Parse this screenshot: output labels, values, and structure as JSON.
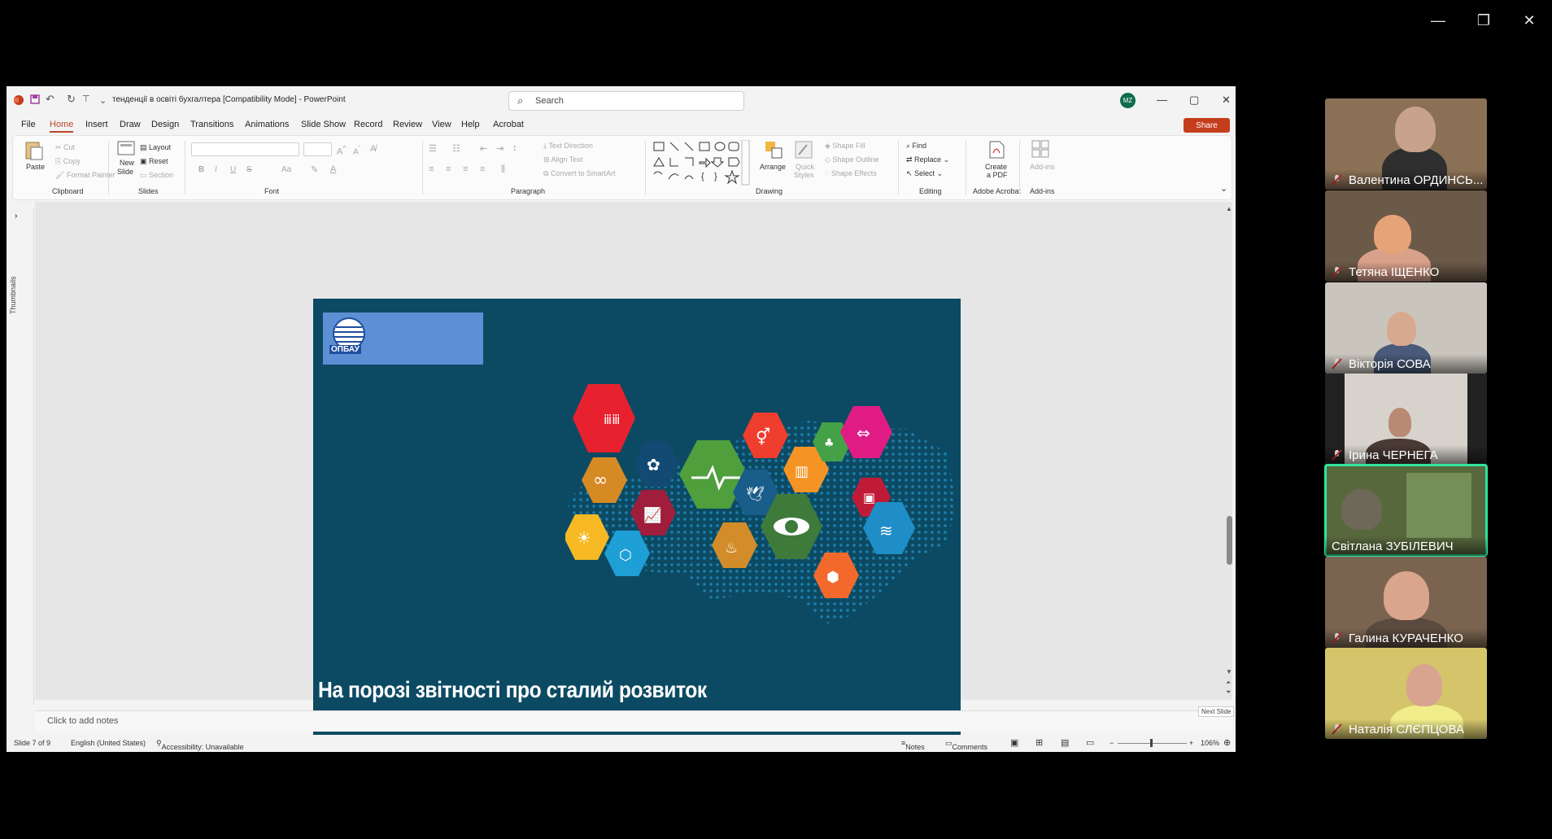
{
  "window_controls": {
    "minimize": "—",
    "restore": "❐",
    "close": "✕"
  },
  "powerpoint": {
    "title": "тенденції в освіті бухгалтера [Compatibility Mode]  -  PowerPoint",
    "search_placeholder": "Search",
    "user_initials": "MZ",
    "menu": [
      "File",
      "Home",
      "Insert",
      "Draw",
      "Design",
      "Transitions",
      "Animations",
      "Slide Show",
      "Record",
      "Review",
      "View",
      "Help",
      "Acrobat"
    ],
    "active_tab": "Home",
    "share_label": "Share",
    "ribbon": {
      "clipboard": {
        "paste": "Paste",
        "cut": "Cut",
        "copy": "Copy",
        "format_painter": "Format Painter",
        "group": "Clipboard"
      },
      "slides": {
        "new_slide_1": "New",
        "new_slide_2": "Slide",
        "layout": "Layout",
        "reset": "Reset",
        "section": "Section",
        "group": "Slides"
      },
      "font": {
        "group": "Font",
        "bold": "B",
        "italic": "I",
        "underline": "U",
        "strike": "S",
        "aa": "Aa"
      },
      "paragraph": {
        "text_direction": "Text Direction",
        "align_text": "Align Text",
        "convert_smartart": "Convert to SmartArt",
        "group": "Paragraph"
      },
      "drawing": {
        "arrange": "Arrange",
        "quick_styles_1": "Quick",
        "quick_styles_2": "Styles",
        "shape_fill": "Shape Fill",
        "shape_outline": "Shape Outline",
        "shape_effects": "Shape Effects",
        "group": "Drawing"
      },
      "editing": {
        "find": "Find",
        "replace": "Replace",
        "select": "Select",
        "group": "Editing"
      },
      "acrobat": {
        "create_pdf_1": "Create",
        "create_pdf_2": "a PDF",
        "group": "Adobe Acrobat"
      },
      "addins": {
        "label": "Add-ins",
        "group": "Add-ins"
      }
    },
    "thumbnails_label": "Thumbnails",
    "slide": {
      "logo_text": "ОПБАУ",
      "title": "На порозі звітності про сталий розвиток"
    },
    "notes_placeholder": "Click to add notes",
    "next_slide_tooltip": "Next Slide",
    "status": {
      "slide_of": "Slide 7 of 9",
      "language": "English (United States)",
      "accessibility": "Accessibility: Unavailable",
      "notes": "Notes",
      "comments": "Comments",
      "zoom": "106%"
    }
  },
  "participants": [
    {
      "name": "Валентина ОРДИНСЬ...",
      "active": false,
      "bg": "#8a7055"
    },
    {
      "name": "Тетяна ІЩЕНКО",
      "active": false,
      "bg": "#6b5a48"
    },
    {
      "name": "Вікторія СОВА",
      "active": false,
      "bg": "#c9c5bd"
    },
    {
      "name": "Ірина ЧЕРНЕГА",
      "active": false,
      "bg": "#d7d3cc"
    },
    {
      "name": "Світлана ЗУБІЛЕВИЧ",
      "active": true,
      "bg": "#57683d"
    },
    {
      "name": "Галина КУРАЧЕНКО",
      "active": false,
      "bg": "#7a6450"
    },
    {
      "name": "Наталія СЛЄПЦОВА",
      "active": false,
      "bg": "#d4c56a"
    }
  ],
  "colors": {
    "accent": "#b7472a",
    "slide_bg": "#0c4a63",
    "speaker_outline": "#2ee59d"
  }
}
